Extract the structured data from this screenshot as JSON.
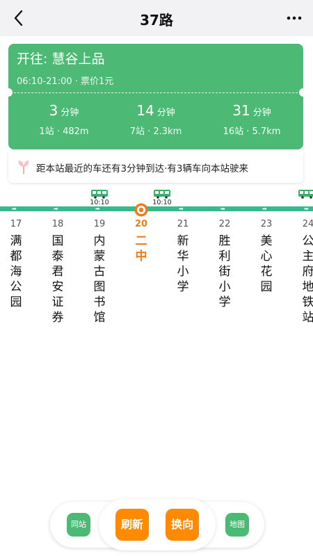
{
  "nav": {
    "title": "37路"
  },
  "card": {
    "destination": "开往: 慧谷上品",
    "hours": "06:10-21:00 · 票价1元",
    "arrivals": [
      {
        "minutes": "3",
        "unit": "分钟",
        "detail": "1站 · 482m"
      },
      {
        "minutes": "14",
        "unit": "分钟",
        "detail": "7站 · 2.3km"
      },
      {
        "minutes": "31",
        "unit": "分钟",
        "detail": "16站 · 5.7km"
      }
    ]
  },
  "notice": {
    "text": "距本站最近的车还有3分钟到达·有3辆车向本站驶来"
  },
  "buses": [
    {
      "time": "10:10"
    },
    {
      "time": "10:10"
    },
    {
      "time": ""
    }
  ],
  "stops": [
    {
      "number": "17",
      "name": "满\n都\n海\n公\n园"
    },
    {
      "number": "18",
      "name": "国\n泰\n君\n安\n证\n券"
    },
    {
      "number": "19",
      "name": "内\n蒙\n古\n图\n书\n馆"
    },
    {
      "number": "20",
      "name": "二\n中",
      "current": true
    },
    {
      "number": "21",
      "name": "新\n华\n小\n学"
    },
    {
      "number": "22",
      "name": "胜\n利\n街\n小\n学"
    },
    {
      "number": "23",
      "name": "美\n心\n花\n园"
    },
    {
      "number": "24",
      "name": "公\n主\n府\n地\n铁\n站"
    }
  ],
  "toolbar": {
    "same_stop": "同站",
    "refresh": "刷新",
    "reverse": "换向",
    "map": "地图"
  },
  "colors": {
    "accent_green": "#4cba74",
    "line_green": "#38b98a",
    "current_orange": "#f07b1c",
    "action_orange": "#ff8a00"
  }
}
